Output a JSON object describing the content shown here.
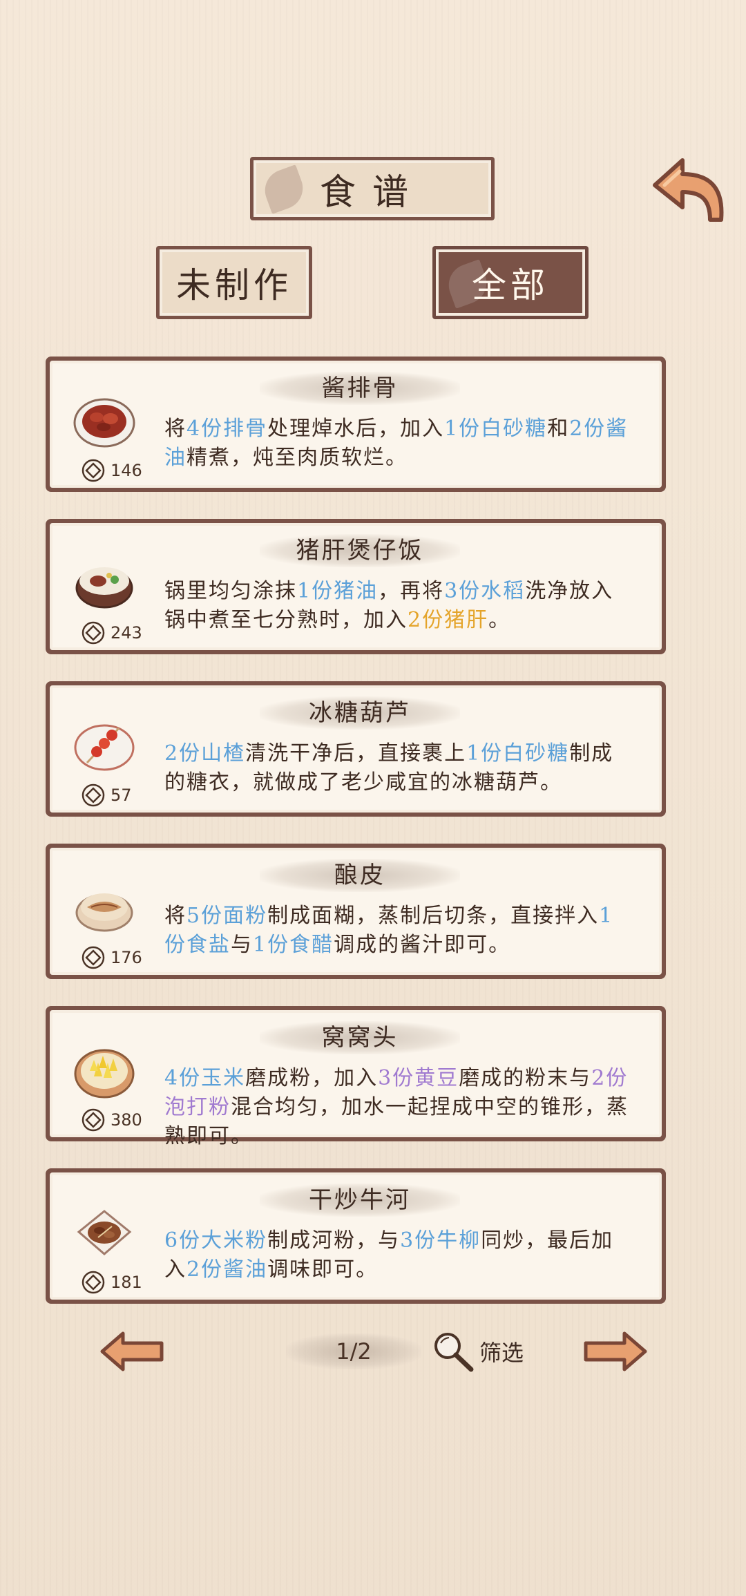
{
  "header": {
    "title": "食谱",
    "tabs": [
      {
        "label": "未制作",
        "active": false
      },
      {
        "label": "全部",
        "active": true
      }
    ]
  },
  "recipes": [
    {
      "name": "酱排骨",
      "price": "146",
      "dish_icon": "braised-ribs-icon",
      "desc": [
        {
          "t": "将",
          "c": ""
        },
        {
          "t": "4份排骨",
          "c": "qb"
        },
        {
          "t": "处理焯水后，加入",
          "c": ""
        },
        {
          "t": "1份白砂糖",
          "c": "qb"
        },
        {
          "t": "和",
          "c": ""
        },
        {
          "t": "2份酱油",
          "c": "qb"
        },
        {
          "t": "精煮，炖至肉质软烂。",
          "c": ""
        }
      ]
    },
    {
      "name": "猪肝煲仔饭",
      "price": "243",
      "dish_icon": "claypot-rice-icon",
      "desc": [
        {
          "t": "锅里均匀涂抹",
          "c": ""
        },
        {
          "t": "1份猪油",
          "c": "qb"
        },
        {
          "t": "，再将",
          "c": ""
        },
        {
          "t": "3份水稻",
          "c": "qb"
        },
        {
          "t": "洗净放入锅中煮至七分熟时，加入",
          "c": ""
        },
        {
          "t": "2份猪肝",
          "c": "qy"
        },
        {
          "t": "。",
          "c": ""
        }
      ]
    },
    {
      "name": "冰糖葫芦",
      "price": "57",
      "dish_icon": "candied-haws-icon",
      "desc": [
        {
          "t": "2份山楂",
          "c": "qb"
        },
        {
          "t": "清洗干净后，直接裹上",
          "c": ""
        },
        {
          "t": "1份白砂糖",
          "c": "qb"
        },
        {
          "t": "制成的糖衣，就做成了老少咸宜的冰糖葫芦。",
          "c": ""
        }
      ]
    },
    {
      "name": "酿皮",
      "price": "176",
      "dish_icon": "liangpi-icon",
      "desc": [
        {
          "t": "将",
          "c": ""
        },
        {
          "t": "5份面粉",
          "c": "qb"
        },
        {
          "t": "制成面糊，蒸制后切条，直接拌入",
          "c": ""
        },
        {
          "t": "1份食盐",
          "c": "qb"
        },
        {
          "t": "与",
          "c": ""
        },
        {
          "t": "1份食醋",
          "c": "qb"
        },
        {
          "t": "调成的酱汁即可。",
          "c": ""
        }
      ]
    },
    {
      "name": "窝窝头",
      "price": "380",
      "dish_icon": "wowotou-icon",
      "desc": [
        {
          "t": "4份玉米",
          "c": "qb"
        },
        {
          "t": "磨成粉，加入",
          "c": ""
        },
        {
          "t": "3份黄豆",
          "c": "qp"
        },
        {
          "t": "磨成的粉末与",
          "c": ""
        },
        {
          "t": "2份泡打粉",
          "c": "qp"
        },
        {
          "t": "混合均匀，加水一起捏成中空的锥形，蒸熟即可。",
          "c": ""
        }
      ]
    },
    {
      "name": "干炒牛河",
      "price": "181",
      "dish_icon": "beef-chow-fun-icon",
      "desc": [
        {
          "t": "6份大米粉",
          "c": "qb"
        },
        {
          "t": "制成河粉，与",
          "c": ""
        },
        {
          "t": "3份牛柳",
          "c": "qb"
        },
        {
          "t": "同炒，最后加入",
          "c": ""
        },
        {
          "t": "2份酱油",
          "c": "qb"
        },
        {
          "t": "调味即可。",
          "c": ""
        }
      ]
    }
  ],
  "pagination": {
    "page": "1/2",
    "filter_label": "筛选"
  },
  "colors": {
    "frame": "#7a5247",
    "parchment": "#fbf5ec",
    "quantity_blue": "#5ba0d8",
    "quantity_yellow": "#e4a42a",
    "quantity_purple": "#a07ad0"
  }
}
